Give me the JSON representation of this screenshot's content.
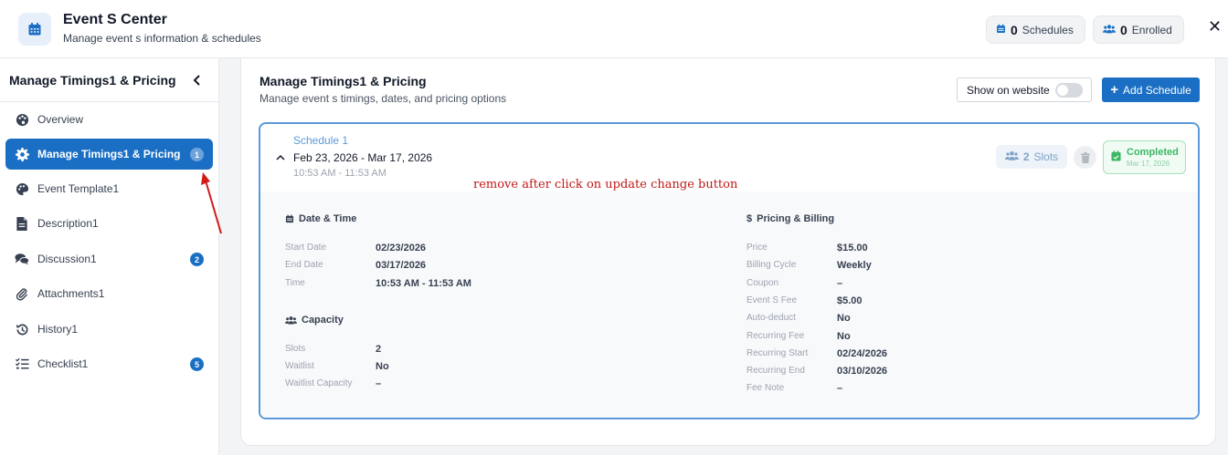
{
  "header": {
    "title": "Event S Center",
    "subtitle": "Manage event s information & schedules",
    "schedules_count": "0",
    "schedules_label": "Schedules",
    "enrolled_count": "0",
    "enrolled_label": "Enrolled",
    "close_label": "✕"
  },
  "sidebar": {
    "title": "Manage Timings1 & Pricing",
    "items": [
      {
        "label": "Overview",
        "icon": "palette-icon"
      },
      {
        "label": "Manage Timings1 & Pricing",
        "icon": "gear-icon",
        "badge": "1",
        "active": true
      },
      {
        "label": "Event Template1",
        "icon": "palette-icon"
      },
      {
        "label": "Description1",
        "icon": "document-icon"
      },
      {
        "label": "Discussion1",
        "icon": "comments-icon",
        "badge": "2"
      },
      {
        "label": "Attachments1",
        "icon": "paperclip-icon"
      },
      {
        "label": "History1",
        "icon": "history-icon"
      },
      {
        "label": "Checklist1",
        "icon": "checklist-icon",
        "badge": "5"
      }
    ]
  },
  "main": {
    "title": "Manage Timings1 & Pricing",
    "subtitle": "Manage event s timings, dates, and pricing options",
    "show_website_label": "Show on website",
    "show_website_on": false,
    "add_schedule_label": "Add Schedule"
  },
  "schedule": {
    "label": "Schedule 1",
    "date_range": "Feb 23, 2026 - Mar 17, 2026",
    "time_range": "10:53 AM - 11:53 AM",
    "slots_count": "2",
    "slots_label": "Slots",
    "status": "Completed",
    "status_date": "Mar 17, 2026",
    "annotation": "remove after click on update change button",
    "date_time": {
      "title": "Date & Time",
      "start_label": "Start Date",
      "start_value": "02/23/2026",
      "end_label": "End Date",
      "end_value": "03/17/2026",
      "time_label": "Time",
      "time_value": "10:53 AM - 11:53 AM"
    },
    "capacity": {
      "title": "Capacity",
      "slots_label": "Slots",
      "slots_value": "2",
      "waitlist_label": "Waitlist",
      "waitlist_value": "No",
      "waitlist_cap_label": "Waitlist Capacity",
      "waitlist_cap_value": "–"
    },
    "pricing": {
      "title": "Pricing & Billing",
      "rows": [
        {
          "label": "Price",
          "value": "$15.00"
        },
        {
          "label": "Billing Cycle",
          "value": "Weekly"
        },
        {
          "label": "Coupon",
          "value": "–"
        },
        {
          "label": "Event S Fee",
          "value": "$5.00"
        },
        {
          "label": "Auto-deduct",
          "value": "No"
        },
        {
          "label": "Recurring Fee",
          "value": "No"
        },
        {
          "label": "Recurring Start",
          "value": "02/24/2026"
        },
        {
          "label": "Recurring End",
          "value": "03/10/2026"
        },
        {
          "label": "Fee Note",
          "value": "–"
        }
      ]
    }
  },
  "colors": {
    "primary": "#1a6fc4",
    "schedule_border": "#5b9ad9",
    "completed": "#3db865",
    "annotation": "#c01818"
  }
}
